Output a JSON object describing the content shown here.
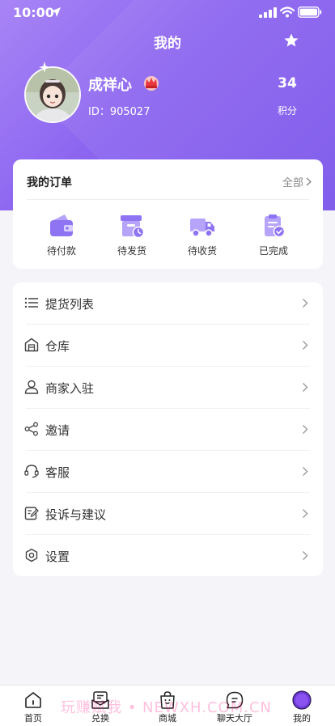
{
  "status_bar": {
    "time": "10:00"
  },
  "header": {
    "title": "我的"
  },
  "profile": {
    "name": "成祥心",
    "id_text": "ID：905027",
    "points_value": "34",
    "points_label": "积分"
  },
  "orders": {
    "title": "我的订单",
    "all_label": "全部",
    "items": [
      {
        "label": "待付款",
        "icon": "wallet-icon"
      },
      {
        "label": "待发货",
        "icon": "box-clock-icon"
      },
      {
        "label": "待收货",
        "icon": "truck-icon"
      },
      {
        "label": "已完成",
        "icon": "clipboard-check-icon"
      }
    ]
  },
  "menu": [
    {
      "label": "提货列表",
      "icon": "list-icon"
    },
    {
      "label": "仓库",
      "icon": "warehouse-icon"
    },
    {
      "label": "商家入驻",
      "icon": "user-icon"
    },
    {
      "label": "邀请",
      "icon": "share-icon"
    },
    {
      "label": "客服",
      "icon": "headset-icon"
    },
    {
      "label": "投诉与建议",
      "icon": "edit-icon"
    },
    {
      "label": "设置",
      "icon": "gear-icon"
    }
  ],
  "tabbar": [
    {
      "label": "首页",
      "icon": "home-icon"
    },
    {
      "label": "兑换",
      "icon": "exchange-icon"
    },
    {
      "label": "商城",
      "icon": "shopping-bag-icon"
    },
    {
      "label": "聊天大厅",
      "icon": "chat-icon"
    },
    {
      "label": "我的",
      "icon": "profile-dot-icon"
    }
  ],
  "watermark": "玩赚赋我 • NEWXH.COM.CN",
  "colors": {
    "accent": "#8b64f0",
    "accent_light": "#a885f6",
    "background": "#f4f4f9"
  }
}
